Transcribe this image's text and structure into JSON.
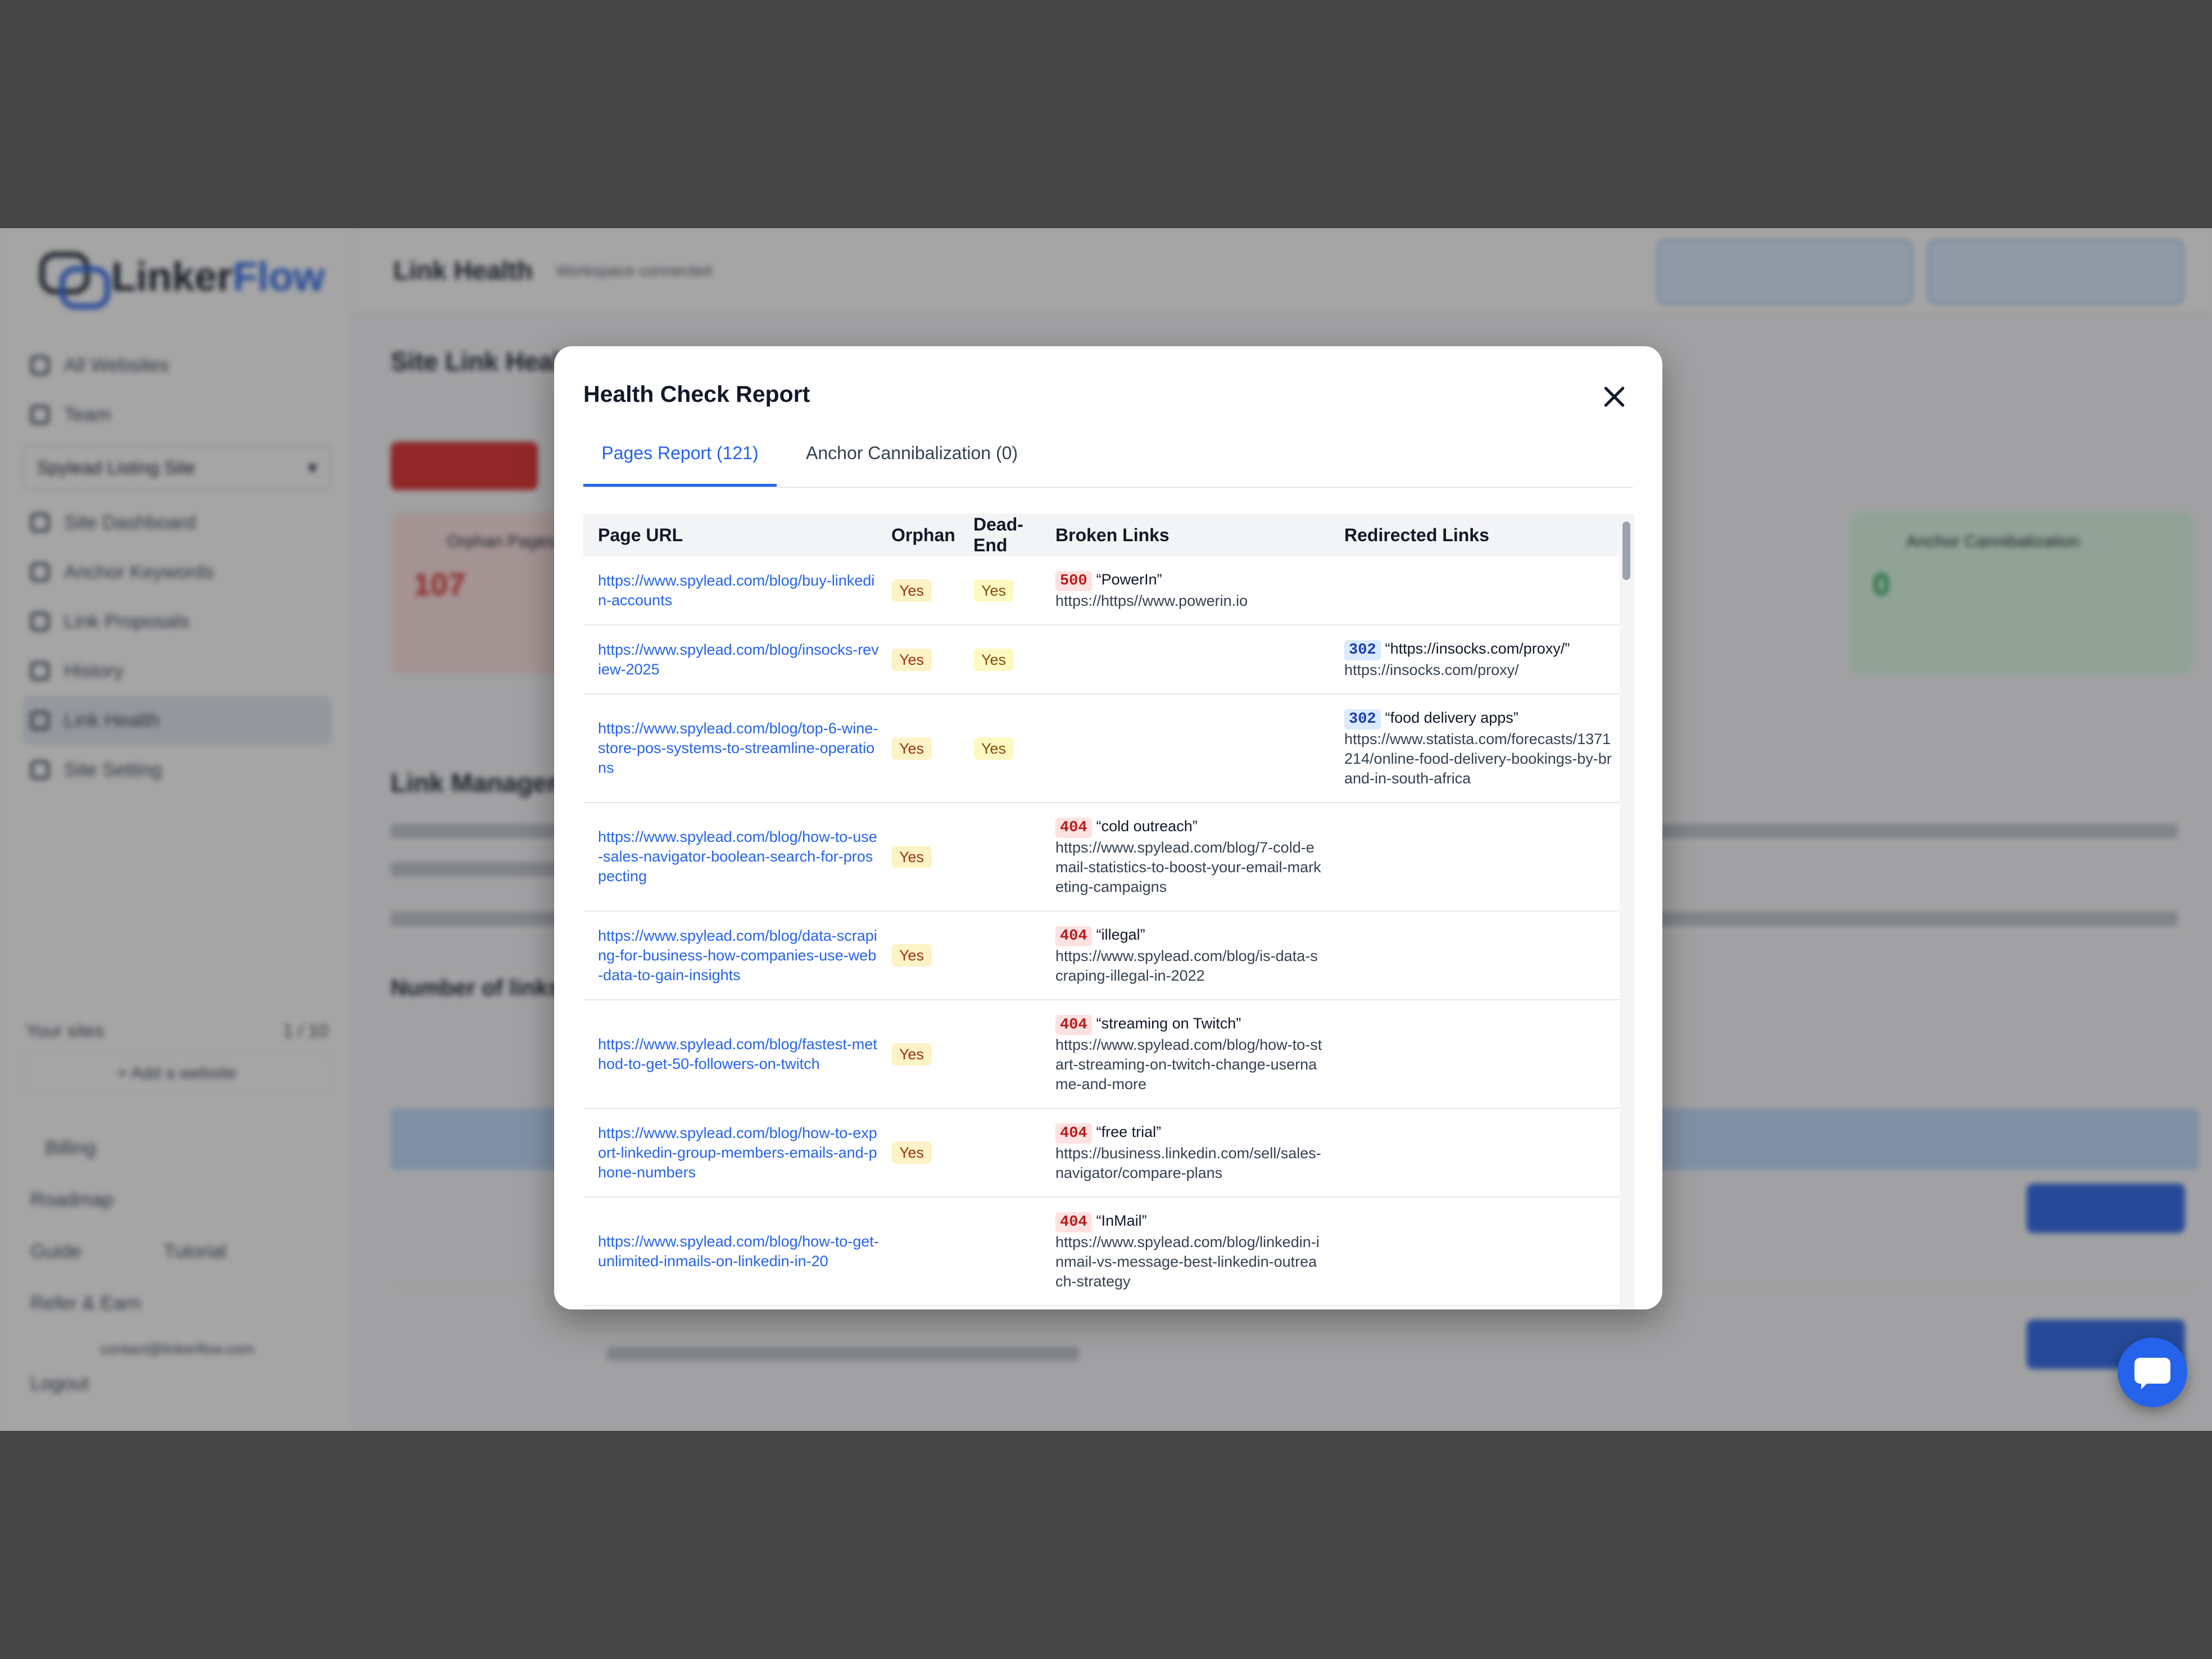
{
  "app": {
    "logo": {
      "word1": "Linker",
      "word2": "Flow"
    },
    "header": {
      "title": "Link Health",
      "workspace_status": "Workspace connected"
    },
    "sidebar": {
      "top_items": [
        {
          "label": "All Websites"
        },
        {
          "label": "Team"
        }
      ],
      "site_select": "Spylead Listing Site",
      "items": [
        {
          "label": "Site Dashboard"
        },
        {
          "label": "Anchor Keywords"
        },
        {
          "label": "Link Proposals"
        },
        {
          "label": "History"
        },
        {
          "label": "Link Health"
        },
        {
          "label": "Site Setting"
        }
      ],
      "your_sites_label": "Your sites",
      "your_sites_count": "1 / 10",
      "add_website": "+ Add a website",
      "footer_items": [
        {
          "label": "Billing"
        },
        {
          "label": "Roadmap"
        },
        {
          "label": "Guide"
        },
        {
          "label": "Refer & Earn"
        }
      ],
      "tutorial": "Tutorial",
      "email": "contact@linkerflow.com",
      "logout": "Logout"
    },
    "main": {
      "section_title": "Site Link Health",
      "section2_title": "Link Management",
      "links_title": "Number of links",
      "card_orphan": "Orphan Pages",
      "card_orphan_value": "107",
      "card_anchor": "Anchor Cannibalization",
      "card_anchor_value": "0"
    }
  },
  "modal": {
    "title": "Health Check Report",
    "tabs": [
      {
        "label": "Pages Report (121)",
        "active": true
      },
      {
        "label": "Anchor Cannibalization (0)",
        "active": false
      }
    ],
    "columns": [
      "Page URL",
      "Orphan",
      "Dead-End",
      "Broken Links",
      "Redirected Links"
    ],
    "rows": [
      {
        "url": "https://www.spylead.com/blog/buy-linkedin-accounts",
        "orphan": "Yes",
        "dead_end": "Yes",
        "broken": {
          "code": "500",
          "anchor": "“PowerIn”",
          "target": "https://https//www.powerin.io"
        },
        "redirected": null
      },
      {
        "url": "https://www.spylead.com/blog/insocks-review-2025",
        "orphan": "Yes",
        "dead_end": "Yes",
        "broken": null,
        "redirected": {
          "code": "302",
          "anchor": "“https://insocks.com/proxy/”",
          "target": "https://insocks.com/proxy/"
        }
      },
      {
        "url": "https://www.spylead.com/blog/top-6-wine-store-pos-systems-to-streamline-operations",
        "orphan": "Yes",
        "dead_end": "Yes",
        "broken": null,
        "redirected": {
          "code": "302",
          "anchor": "“food delivery apps”",
          "target": "https://www.statista.com/forecasts/1371214/online-food-delivery-bookings-by-brand-in-south-africa"
        }
      },
      {
        "url": "https://www.spylead.com/blog/how-to-use-sales-navigator-boolean-search-for-prospecting",
        "orphan": "Yes",
        "dead_end": "",
        "broken": {
          "code": "404",
          "anchor": "“cold outreach”",
          "target": "https://www.spylead.com/blog/7-cold-email-statistics-to-boost-your-email-marketing-campaigns"
        },
        "redirected": null
      },
      {
        "url": "https://www.spylead.com/blog/data-scraping-for-business-how-companies-use-web-data-to-gain-insights",
        "orphan": "Yes",
        "dead_end": "",
        "broken": {
          "code": "404",
          "anchor": "“illegal”",
          "target": "https://www.spylead.com/blog/is-data-scraping-illegal-in-2022"
        },
        "redirected": null
      },
      {
        "url": "https://www.spylead.com/blog/fastest-method-to-get-50-followers-on-twitch",
        "orphan": "Yes",
        "dead_end": "",
        "broken": {
          "code": "404",
          "anchor": "“streaming on Twitch”",
          "target": "https://www.spylead.com/blog/how-to-start-streaming-on-twitch-change-username-and-more"
        },
        "redirected": null
      },
      {
        "url": "https://www.spylead.com/blog/how-to-export-linkedin-group-members-emails-and-phone-numbers",
        "orphan": "Yes",
        "dead_end": "",
        "broken": {
          "code": "404",
          "anchor": "“free trial”",
          "target": "https://business.linkedin.com/sell/sales-navigator/compare-plans"
        },
        "redirected": null
      },
      {
        "url": "https://www.spylead.com/blog/how-to-get-unlimited-inmails-on-linkedin-in-20",
        "orphan": "",
        "dead_end": "",
        "broken": {
          "code": "404",
          "anchor": "“InMail”",
          "target": "https://www.spylead.com/blog/linkedin-inmail-vs-message-best-linkedin-outreach-strategy"
        },
        "redirected": null
      }
    ]
  },
  "colors": {
    "accent": "#2563eb",
    "yes_bg": "#fef3c7",
    "error_code_bg": "#fee2e2",
    "redirect_code_bg": "#dbeafe"
  }
}
